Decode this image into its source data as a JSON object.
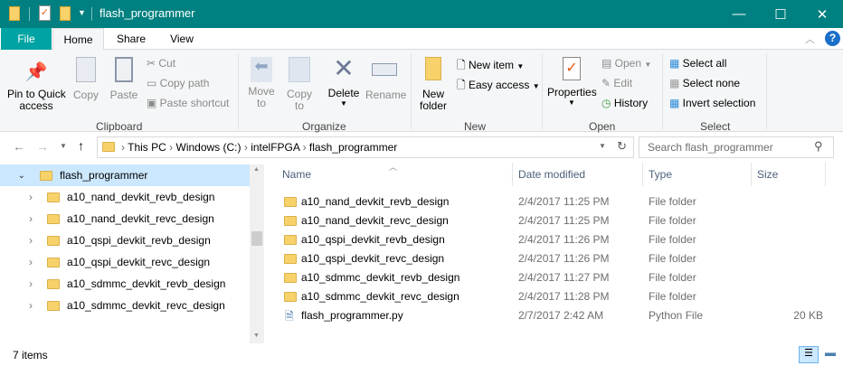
{
  "window": {
    "title": "flash_programmer",
    "minimize": "—",
    "maximize": "☐",
    "close": "✕"
  },
  "tabs": {
    "file": "File",
    "home": "Home",
    "share": "Share",
    "view": "View"
  },
  "ribbon": {
    "clipboard": {
      "group": "Clipboard",
      "pin": [
        "Pin to Quick",
        "access"
      ],
      "copy": "Copy",
      "paste": "Paste",
      "cut": "Cut",
      "copy_path": "Copy path",
      "paste_shortcut": "Paste shortcut"
    },
    "organize": {
      "group": "Organize",
      "move_to": [
        "Move",
        "to"
      ],
      "copy_to": [
        "Copy",
        "to"
      ],
      "delete": "Delete",
      "rename": "Rename"
    },
    "new": {
      "group": "New",
      "new_folder": [
        "New",
        "folder"
      ],
      "new_item": "New item",
      "easy_access": "Easy access"
    },
    "open": {
      "group": "Open",
      "properties": "Properties",
      "open": "Open",
      "edit": "Edit",
      "history": "History"
    },
    "select": {
      "group": "Select",
      "select_all": "Select all",
      "select_none": "Select none",
      "invert": "Invert selection"
    }
  },
  "address": {
    "crumbs": [
      "This PC",
      "Windows (C:)",
      "intelFPGA",
      "flash_programmer"
    ],
    "search_placeholder": "Search flash_programmer"
  },
  "tree": {
    "root": "flash_programmer",
    "items": [
      "a10_nand_devkit_revb_design",
      "a10_nand_devkit_revc_design",
      "a10_qspi_devkit_revb_design",
      "a10_qspi_devkit_revc_design",
      "a10_sdmmc_devkit_revb_design",
      "a10_sdmmc_devkit_revc_design"
    ]
  },
  "columns": {
    "name": "Name",
    "date": "Date modified",
    "type": "Type",
    "size": "Size"
  },
  "files": [
    {
      "name": "a10_nand_devkit_revb_design",
      "date": "2/4/2017 11:25 PM",
      "type": "File folder",
      "size": ""
    },
    {
      "name": "a10_nand_devkit_revc_design",
      "date": "2/4/2017 11:25 PM",
      "type": "File folder",
      "size": ""
    },
    {
      "name": "a10_qspi_devkit_revb_design",
      "date": "2/4/2017 11:26 PM",
      "type": "File folder",
      "size": ""
    },
    {
      "name": "a10_qspi_devkit_revc_design",
      "date": "2/4/2017 11:26 PM",
      "type": "File folder",
      "size": ""
    },
    {
      "name": "a10_sdmmc_devkit_revb_design",
      "date": "2/4/2017 11:27 PM",
      "type": "File folder",
      "size": ""
    },
    {
      "name": "a10_sdmmc_devkit_revc_design",
      "date": "2/4/2017 11:28 PM",
      "type": "File folder",
      "size": ""
    },
    {
      "name": "flash_programmer.py",
      "date": "2/7/2017 2:42 AM",
      "type": "Python File",
      "size": "20 KB"
    }
  ],
  "status": {
    "count": "7 items"
  }
}
